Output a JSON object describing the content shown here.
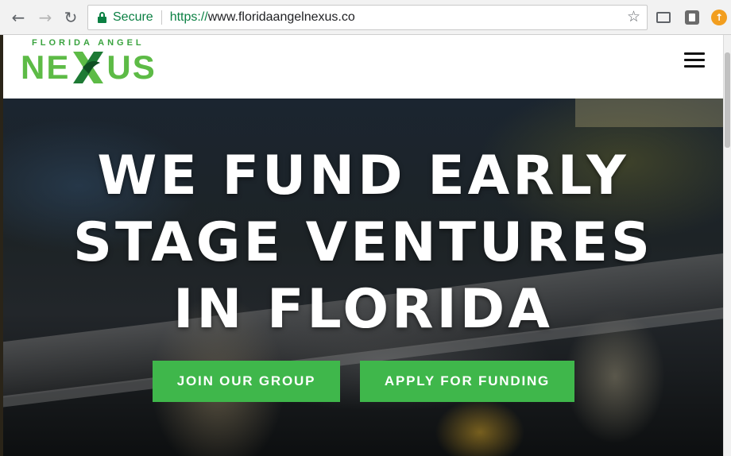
{
  "browser": {
    "back_icon": "arrow-left-icon",
    "forward_icon": "arrow-right-icon",
    "reload_icon": "reload-icon",
    "secure_label": "Secure",
    "url_scheme": "https://",
    "url_host": "www.floridaangelnexus.co",
    "bookmark_icon": "star-icon",
    "extensions": [
      "cast-icon",
      "pocket-icon",
      "upload-icon"
    ]
  },
  "site": {
    "logo_top": "FLORIDA ANGEL",
    "logo_left": "NE",
    "logo_right": "US",
    "menu_icon": "hamburger-icon",
    "brand_color": "#3fb74b"
  },
  "hero": {
    "title_line1": "WE FUND EARLY",
    "title_line2": "STAGE VENTURES",
    "title_line3": "IN FLORIDA",
    "join_label": "JOIN OUR GROUP",
    "apply_label": "APPLY FOR FUNDING"
  }
}
